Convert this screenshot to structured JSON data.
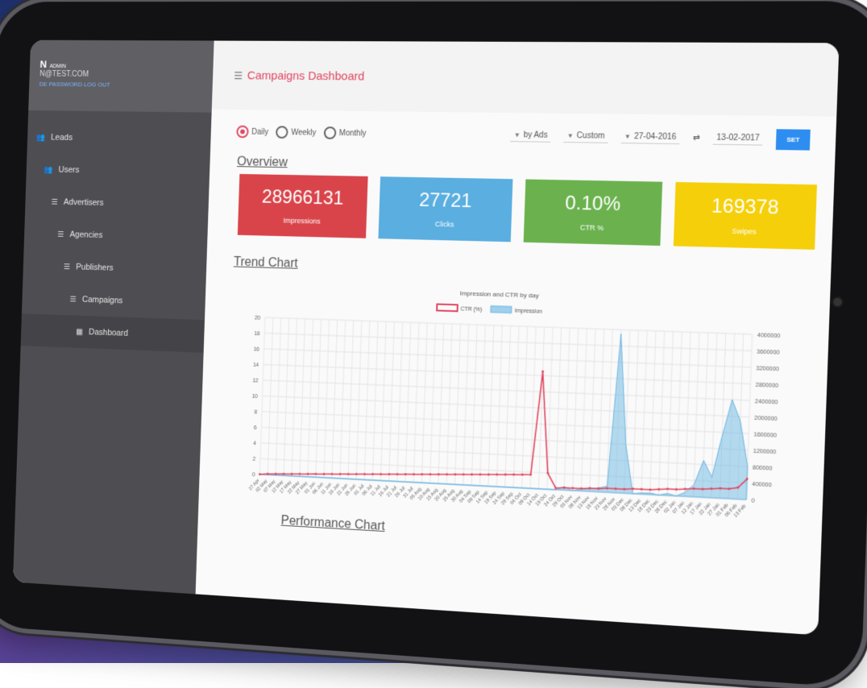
{
  "sidebar": {
    "user_name": "N",
    "user_role": "ADMIN",
    "user_email": "N@TEST.COM",
    "links": "DE PASSWORD  LOG OUT",
    "items": [
      {
        "label": "Leads",
        "icon": "users-icon"
      },
      {
        "label": "Users",
        "icon": "users-icon"
      },
      {
        "label": "Advertisers",
        "icon": "list-icon"
      },
      {
        "label": "Agencies",
        "icon": "list-icon"
      },
      {
        "label": "Publishers",
        "icon": "list-icon"
      },
      {
        "label": "Campaigns",
        "icon": "list-icon"
      },
      {
        "label": "Dashboard",
        "icon": "dashboard-icon"
      }
    ]
  },
  "header": {
    "title": "Campaigns Dashboard"
  },
  "filters": {
    "period_options": [
      "Daily",
      "Weekly",
      "Monthly"
    ],
    "period_selected": "Daily",
    "group_by": "by Ads",
    "range_type": "Custom",
    "date_from": "27-04-2016",
    "date_to": "13-02-2017",
    "set_label": "SET"
  },
  "overview": {
    "title": "Overview",
    "cards": [
      {
        "value": "28966131",
        "label": "Impressions",
        "color": "#d9444b"
      },
      {
        "value": "27721",
        "label": "Clicks",
        "color": "#5aaee0"
      },
      {
        "value": "0.10%",
        "label": "CTR %",
        "color": "#6bb24f"
      },
      {
        "value": "169378",
        "label": "Swipes",
        "color": "#f5cf0a"
      }
    ]
  },
  "trend": {
    "title": "Trend Chart"
  },
  "performance": {
    "title": "Performance Chart"
  },
  "chart_data": {
    "type": "line",
    "title": "Impression and CTR by day",
    "legend": [
      "CTR (%)",
      "Impression"
    ],
    "legend_position": "top",
    "grid": true,
    "y_left": {
      "min": 0,
      "max": 20,
      "ticks": [
        0,
        2,
        4,
        6,
        8,
        10,
        12,
        14,
        16,
        18,
        20
      ]
    },
    "y_right": {
      "min": 0,
      "max": 4000000,
      "ticks": [
        0,
        400000,
        800000,
        1200000,
        1600000,
        2000000,
        2400000,
        2800000,
        3200000,
        3600000,
        4000000
      ]
    },
    "x_labels": [
      "27 Apr",
      "02 May",
      "07 May",
      "12 May",
      "17 May",
      "22 May",
      "27 May",
      "01 Jun",
      "06 Jun",
      "11 Jun",
      "16 Jun",
      "21 Jun",
      "26 Jun",
      "01 Jul",
      "06 Jul",
      "11 Jul",
      "16 Jul",
      "21 Jul",
      "26 Jul",
      "31 Jul",
      "05 Aug",
      "10 Aug",
      "15 Aug",
      "20 Aug",
      "25 Aug",
      "30 Aug",
      "04 Sep",
      "09 Sep",
      "14 Sep",
      "19 Sep",
      "24 Sep",
      "29 Sep",
      "04 Oct",
      "09 Oct",
      "14 Oct",
      "19 Oct",
      "24 Oct",
      "29 Oct",
      "03 Nov",
      "08 Nov",
      "13 Nov",
      "18 Nov",
      "23 Nov",
      "28 Nov",
      "03 Dec",
      "08 Dec",
      "13 Dec",
      "18 Dec",
      "23 Dec",
      "28 Dec",
      "02 Jan",
      "07 Jan",
      "12 Jan",
      "17 Jan",
      "22 Jan",
      "27 Jan",
      "01 Feb",
      "06 Feb",
      "13 Feb"
    ],
    "ctr_series": [
      0,
      0.1,
      0.15,
      0.2,
      0.25,
      0.3,
      0.35,
      0.4,
      0.45,
      0.5,
      0.55,
      0.6,
      0.65,
      0.7,
      0.75,
      0.8,
      0.85,
      0.9,
      0.95,
      1.0,
      1.05,
      1.1,
      1.15,
      1.2,
      1.25,
      1.3,
      1.35,
      1.4,
      1.45,
      1.5,
      1.55,
      1.6,
      1.65,
      1.7,
      14.5,
      2.0,
      0.2,
      0.3,
      0.3,
      0.3,
      0.4,
      0.4,
      0.5,
      0.5,
      0.5,
      0.6,
      0.6,
      0.6,
      0.7,
      0.8,
      0.8,
      0.9,
      1.0,
      1.0,
      1.1,
      1.2,
      1.2,
      1.4,
      2.5
    ],
    "impression_series": [
      0,
      0,
      0,
      0,
      0,
      0,
      0,
      0,
      0,
      0,
      0,
      0,
      0,
      0,
      0,
      0,
      0,
      0,
      0,
      0,
      0,
      0,
      0,
      0,
      0,
      0,
      0,
      0,
      0,
      0,
      0,
      0,
      0,
      0,
      0,
      0,
      0,
      80000,
      0,
      50000,
      60000,
      100000,
      150000,
      3900000,
      1200000,
      0,
      30000,
      40000,
      0,
      50000,
      0,
      100000,
      300000,
      900000,
      500000,
      1500000,
      2400000,
      1900000,
      800000
    ]
  }
}
